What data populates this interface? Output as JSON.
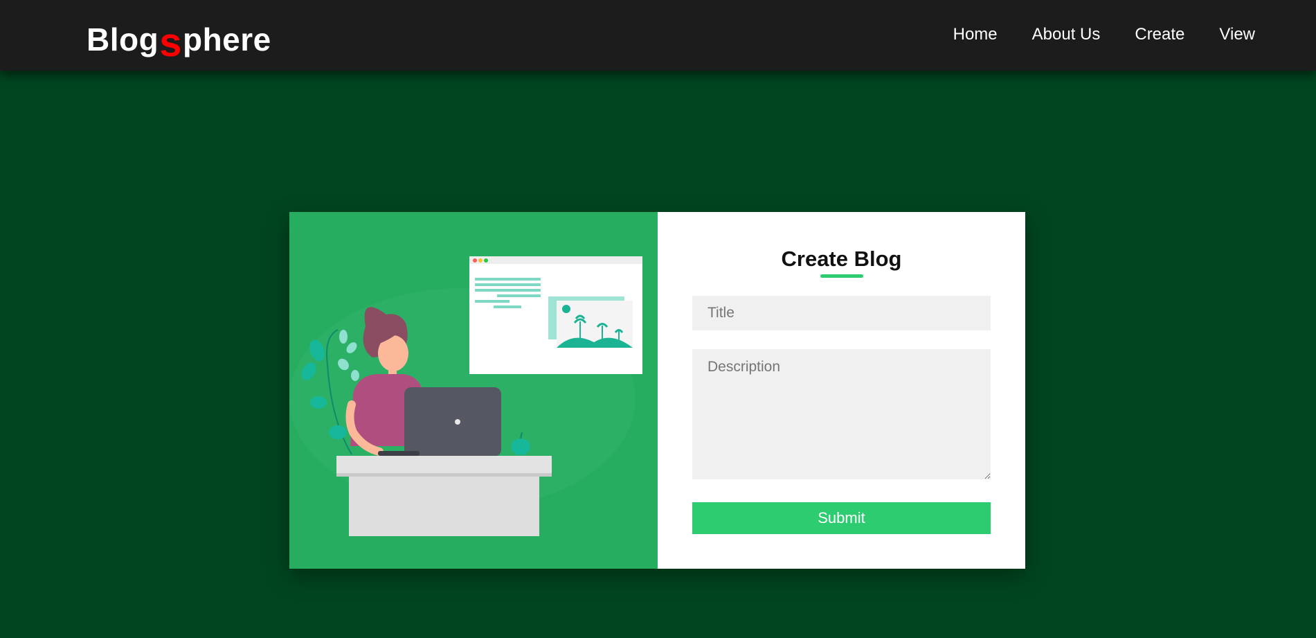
{
  "brand": {
    "part1": "Blog",
    "accent": "s",
    "part2": "phere"
  },
  "nav": {
    "items": [
      "Home",
      "About Us",
      "Create",
      "View"
    ]
  },
  "form": {
    "heading": "Create Blog",
    "title_placeholder": "Title",
    "description_placeholder": "Description",
    "submit_label": "Submit"
  },
  "colors": {
    "page_background": "#01451f",
    "navbar": "#1c1c1c",
    "brand_accent": "#ff0000",
    "illustration_background": "#27ad60",
    "primary_button": "#2ecc71"
  }
}
